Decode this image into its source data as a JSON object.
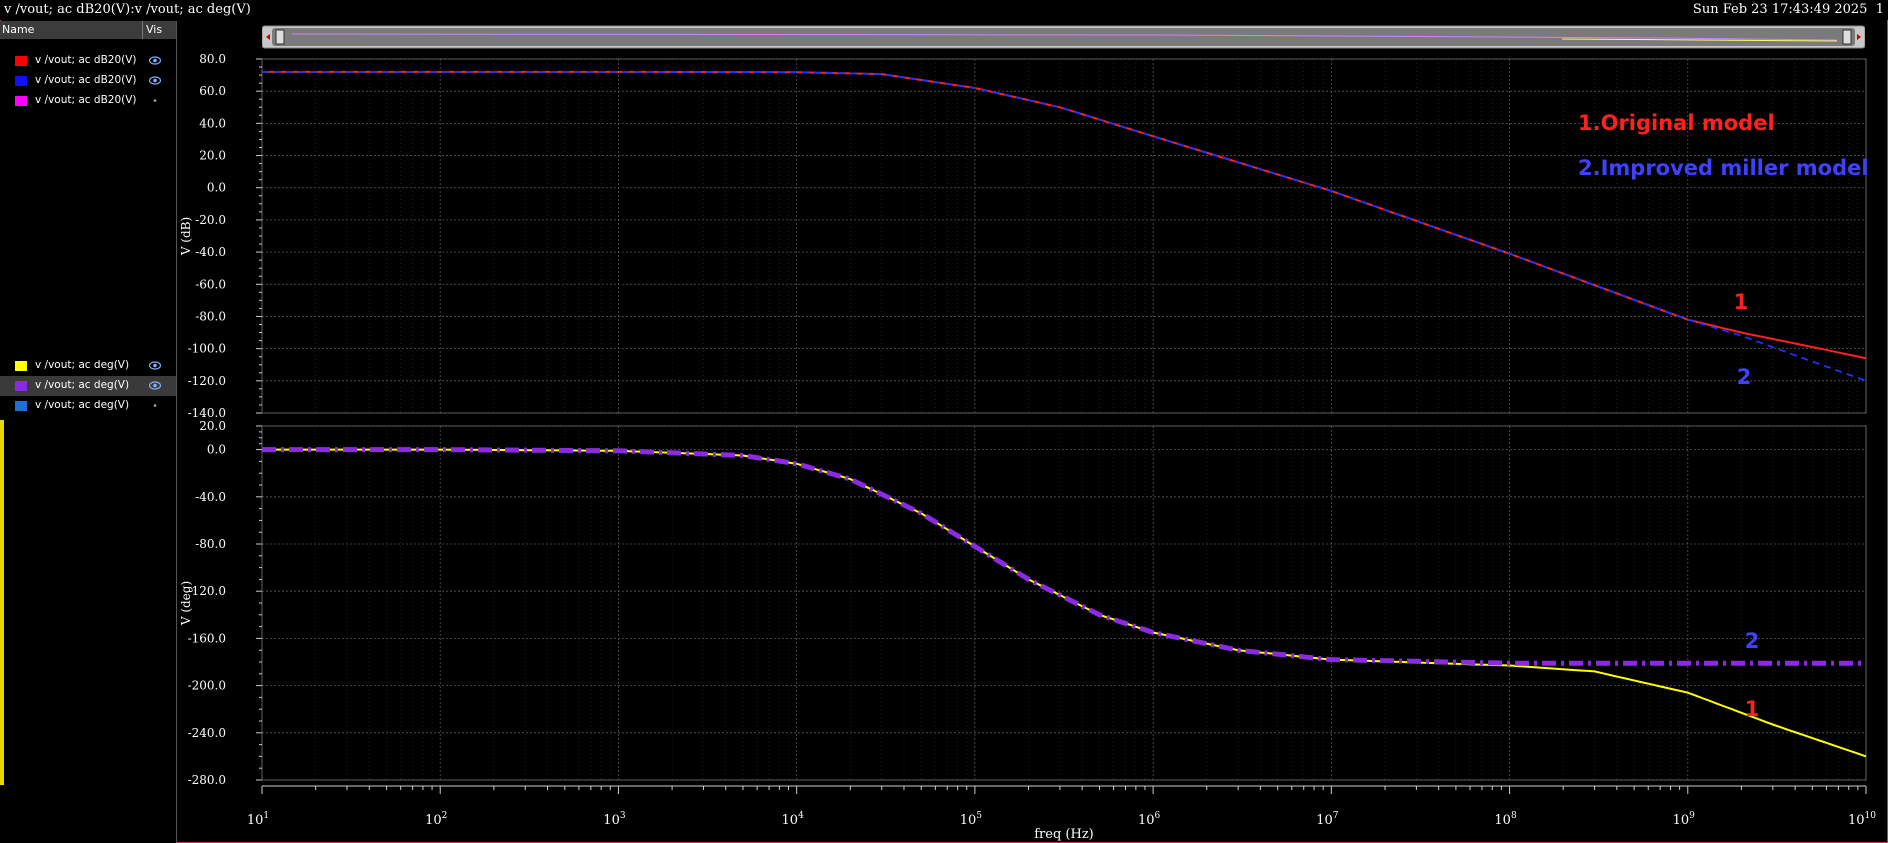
{
  "window": {
    "title": "v /vout; ac dB20(V):v /vout; ac deg(V)",
    "timestamp": "Sun Feb 23 17:43:49 2025",
    "page": "1"
  },
  "legend": {
    "header_name": "Name",
    "header_vis": "Vis",
    "top": [
      {
        "label": "v /vout; ac dB20(V)",
        "color": "#ff0000",
        "vis": "eye"
      },
      {
        "label": "v /vout; ac dB20(V)",
        "color": "#1010ff",
        "vis": "eye"
      },
      {
        "label": "v /vout; ac dB20(V)",
        "color": "#ff00ff",
        "vis": "dot"
      }
    ],
    "bottom": [
      {
        "label": "v /vout; ac deg(V)",
        "color": "#ffff00",
        "vis": "eye",
        "selected": false
      },
      {
        "label": "v /vout; ac deg(V)",
        "color": "#8a2be2",
        "vis": "eye",
        "selected": true
      },
      {
        "label": "v /vout; ac deg(V)",
        "color": "#1e6fd8",
        "vis": "dot",
        "selected": false
      }
    ]
  },
  "chart_data": [
    {
      "type": "line",
      "ylabel": "V (dB)",
      "ylim": [
        -140,
        80
      ],
      "yticks": [
        "80.0",
        "60.0",
        "40.0",
        "20.0",
        "0.0",
        "-20.0",
        "-40.0",
        "-60.0",
        "-80.0",
        "-100.0",
        "-120.0",
        "-140.0"
      ],
      "x_scale": "log",
      "xlim": [
        10,
        10000000000
      ],
      "series": [
        {
          "color": "#ff2020",
          "x": [
            10,
            100,
            1000,
            10000,
            30000,
            100000,
            300000,
            1000000,
            10000000,
            100000000,
            1000000000,
            2000000000,
            5000000000,
            10000000000
          ],
          "y": [
            72,
            72,
            72,
            71.8,
            70.6,
            62,
            50,
            32,
            -2,
            -41,
            -82,
            -90,
            -99,
            -106
          ]
        },
        {
          "color": "#2030ff",
          "x": [
            10,
            100,
            1000,
            10000,
            30000,
            100000,
            300000,
            1000000,
            10000000,
            100000000,
            1000000000,
            2000000000,
            5000000000,
            10000000000
          ],
          "y": [
            72,
            72,
            72,
            71.8,
            70.6,
            62,
            50,
            32,
            -2,
            -41,
            -82,
            -92,
            -108,
            -120
          ]
        }
      ],
      "annotations": [
        {
          "text": "1.Original model",
          "color": "#ff2020"
        },
        {
          "text": "2.Improved miller model",
          "color": "#4040ff"
        },
        {
          "text": "1",
          "color": "#ff2020"
        },
        {
          "text": "2",
          "color": "#4040ff"
        }
      ],
      "grid": true
    },
    {
      "type": "line",
      "ylabel": "V (deg)",
      "ylim": [
        -280,
        20
      ],
      "yticks": [
        "20.0",
        "0.0",
        "-40.0",
        "-80.0",
        "-120.0",
        "-160.0",
        "-200.0",
        "-240.0",
        "-280.0"
      ],
      "x_scale": "log",
      "xlim": [
        10,
        10000000000
      ],
      "xlabel": "freq (Hz)",
      "xticks": [
        "10",
        "100",
        "1000",
        "10000",
        "100000",
        "1000000",
        "10000000",
        "100000000",
        "1000000000",
        "10000000000"
      ],
      "series": [
        {
          "color": "#ffff00",
          "x": [
            10,
            100,
            1000,
            5000,
            10000,
            20000,
            50000,
            100000,
            200000,
            500000,
            1000000,
            3000000,
            10000000,
            100000000,
            300000000,
            1000000000,
            3000000000,
            10000000000
          ],
          "y": [
            0,
            0,
            -1,
            -5,
            -12,
            -25,
            -54,
            -82,
            -110,
            -140,
            -155,
            -170,
            -178,
            -183,
            -188,
            -206,
            -233,
            -260
          ]
        },
        {
          "color": "#8a2be2",
          "x": [
            10,
            100,
            1000,
            5000,
            10000,
            20000,
            50000,
            100000,
            200000,
            500000,
            1000000,
            3000000,
            10000000,
            100000000,
            1000000000,
            10000000000
          ],
          "y": [
            0,
            0,
            -1,
            -5,
            -12,
            -25,
            -54,
            -82,
            -110,
            -140,
            -155,
            -170,
            -178,
            -181,
            -181,
            -181
          ]
        }
      ],
      "annotations": [
        {
          "text": "2",
          "color": "#4040ff"
        },
        {
          "text": "1",
          "color": "#ff2020"
        }
      ],
      "grid": true
    }
  ]
}
